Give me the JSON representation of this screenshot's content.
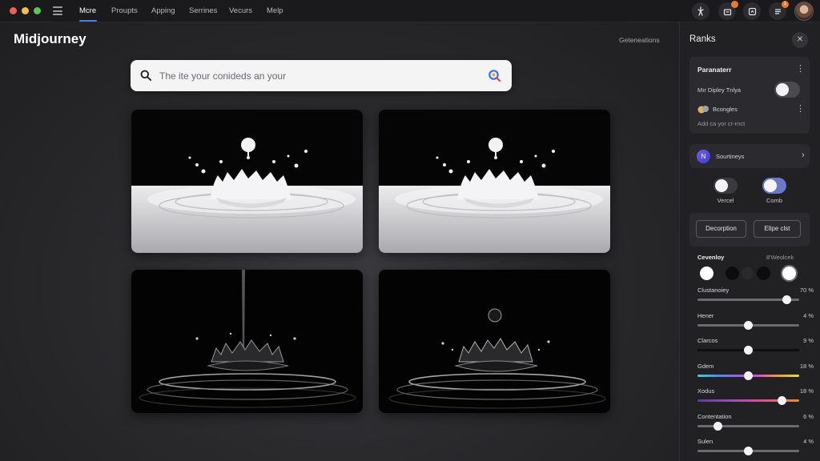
{
  "topbar": {
    "nav": [
      "Mcre",
      "Proupts",
      "Apping",
      "Serrines",
      "Vecurs",
      "Melp"
    ],
    "active_index": 0,
    "notif_badge": "",
    "tasks_badge": "1"
  },
  "main": {
    "brand": "Midjourney",
    "generations_link": "Geteneations",
    "search": {
      "placeholder": "The ite your conideds an your",
      "value": ""
    }
  },
  "panel": {
    "title": "Ranks",
    "parameters": {
      "title": "Paranaterr",
      "toggle_label": "Mır Dipley Tnlya",
      "toggle_on": false,
      "item_label": "Bcongles",
      "item_sub": "Add ca yor cr-rnct"
    },
    "sources": {
      "label": "Sourtineys"
    },
    "modes": [
      {
        "label": "Vercel",
        "on": false
      },
      {
        "label": "Comb",
        "on": true
      }
    ],
    "buttons": [
      "Decorption",
      "Elipe clst"
    ],
    "ceventay": {
      "title": "Cevenloy",
      "right": "8'Weolcek"
    },
    "swatches": [
      "#ffffff",
      "#0c0c0e",
      "#2a2a2e",
      "#0c0c0e",
      "#ffffff"
    ],
    "sliders": [
      {
        "label": "Clustanoiey",
        "value": "70 %",
        "level": 0.88,
        "track": "#6a6a70"
      },
      {
        "label": "Hener",
        "value": "4 %",
        "level": 0.5,
        "track": "#6a6a70"
      },
      {
        "label": "Clarcos",
        "value": "9 %",
        "level": 0.5,
        "track": "#0e0e10"
      },
      {
        "label": "Gdem",
        "value": "18 %",
        "level": 0.5,
        "track": "rainbow"
      },
      {
        "label": "Xodus",
        "value": "18 %",
        "level": 0.83,
        "track": "warm"
      },
      {
        "label": "Contentation",
        "value": "6 %",
        "level": 0.2,
        "track": "#6a6a70"
      },
      {
        "label": "Sulen",
        "value": "4 %",
        "level": 0.5,
        "track": "#6a6a70"
      }
    ]
  },
  "colors": {
    "accent": "#4c7df0",
    "badge": "#f07a2a"
  },
  "icons": [
    "menu-icon",
    "tool-icon",
    "notification-icon",
    "share-icon",
    "tasks-icon",
    "search-icon",
    "lens-icon",
    "close-icon",
    "more-icon",
    "chevron-right-icon"
  ]
}
